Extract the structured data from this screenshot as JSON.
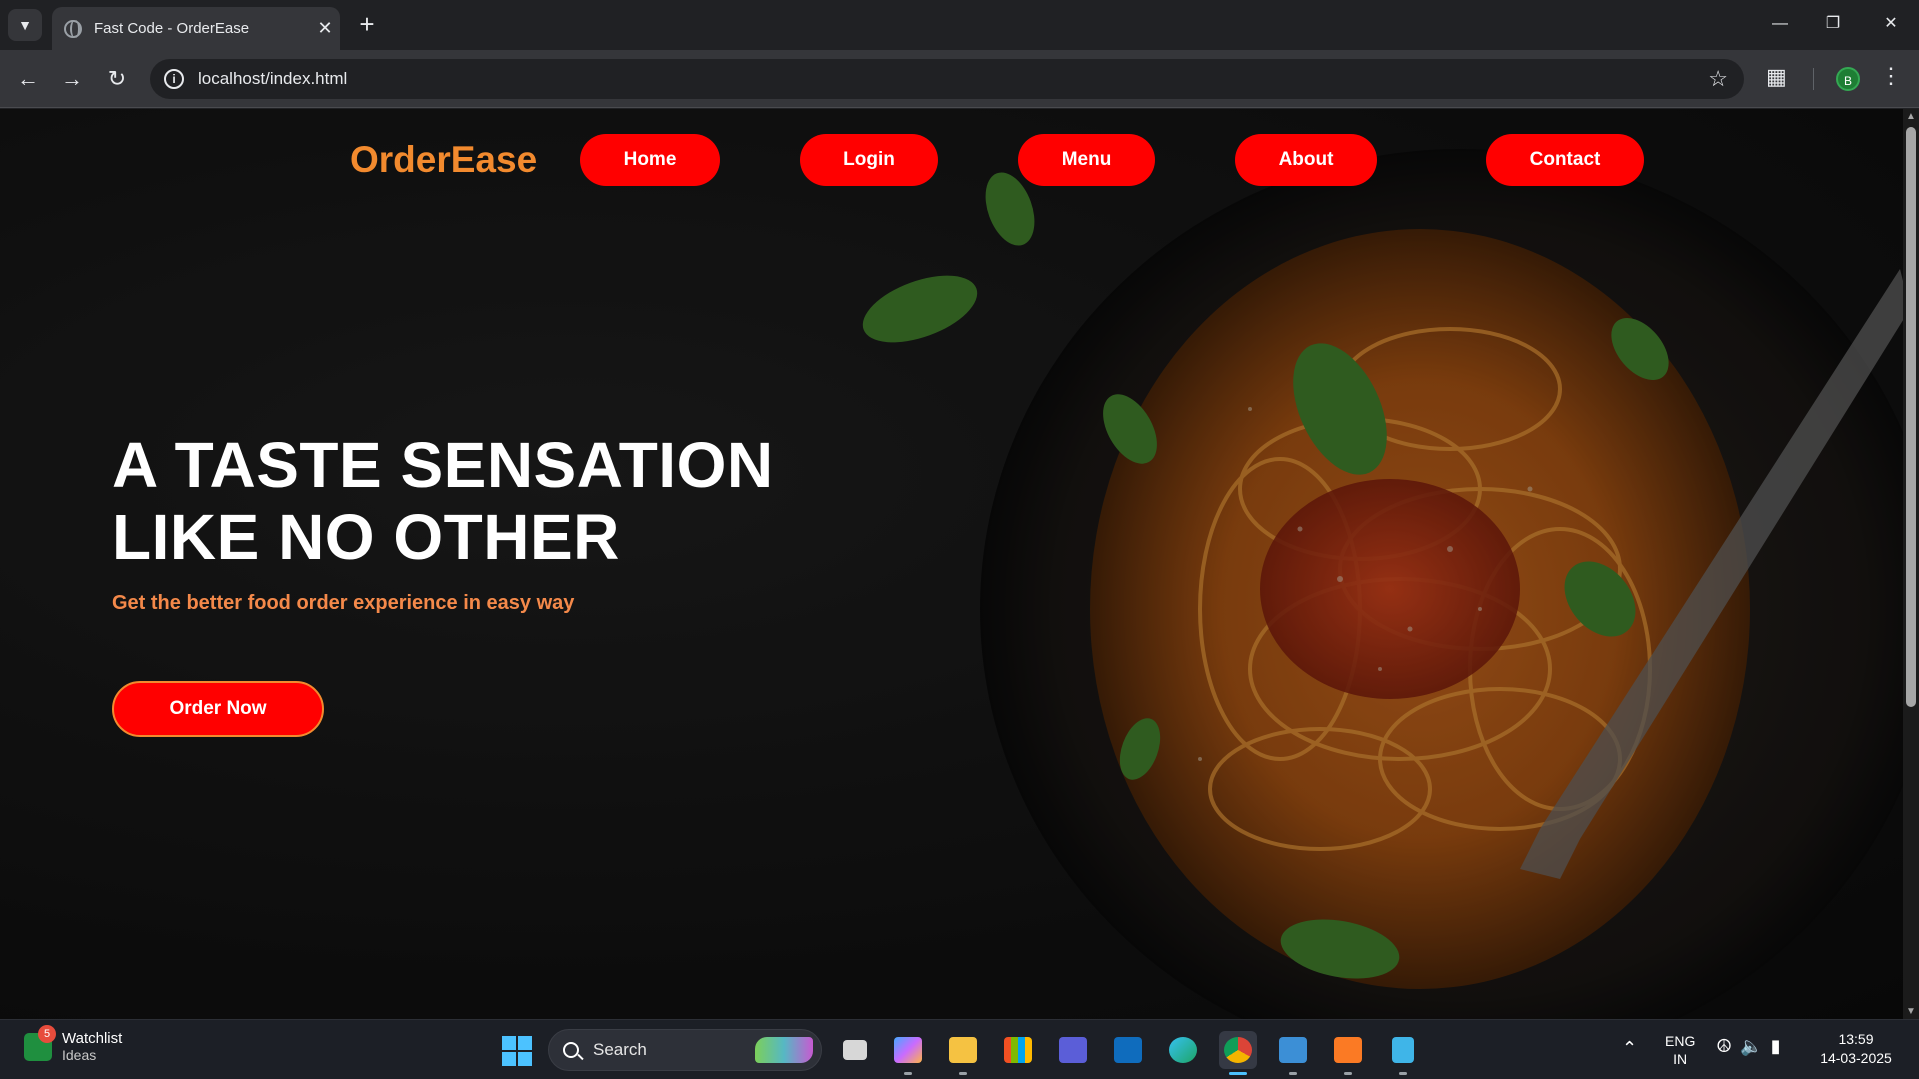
{
  "browser": {
    "tab_title": "Fast Code - OrderEase",
    "url": "localhost/index.html",
    "profile_initial": "B"
  },
  "site": {
    "brand": "OrderEase",
    "brand_color": "#f28a2e",
    "accent_color": "#ff0000",
    "nav": [
      {
        "label": "Home"
      },
      {
        "label": "Login"
      },
      {
        "label": "Menu"
      },
      {
        "label": "About"
      },
      {
        "label": "Contact"
      }
    ],
    "hero": {
      "title_line1": "A TASTE SENSATION",
      "title_line2": "LIKE NO OTHER",
      "subtitle": "Get the better food order experience in easy way",
      "cta_label": "Order Now"
    }
  },
  "taskbar": {
    "widget_badge": "5",
    "widget_title": "Watchlist",
    "widget_subtitle": "Ideas",
    "search_label": "Search",
    "lang_line1": "ENG",
    "lang_line2": "IN",
    "time": "13:59",
    "date": "14-03-2025",
    "apps": [
      "task-view",
      "copilot",
      "file-explorer",
      "microsoft-store",
      "visual-studio",
      "outlook",
      "edge",
      "chrome",
      "remote-desktop",
      "xampp",
      "notepad"
    ]
  }
}
